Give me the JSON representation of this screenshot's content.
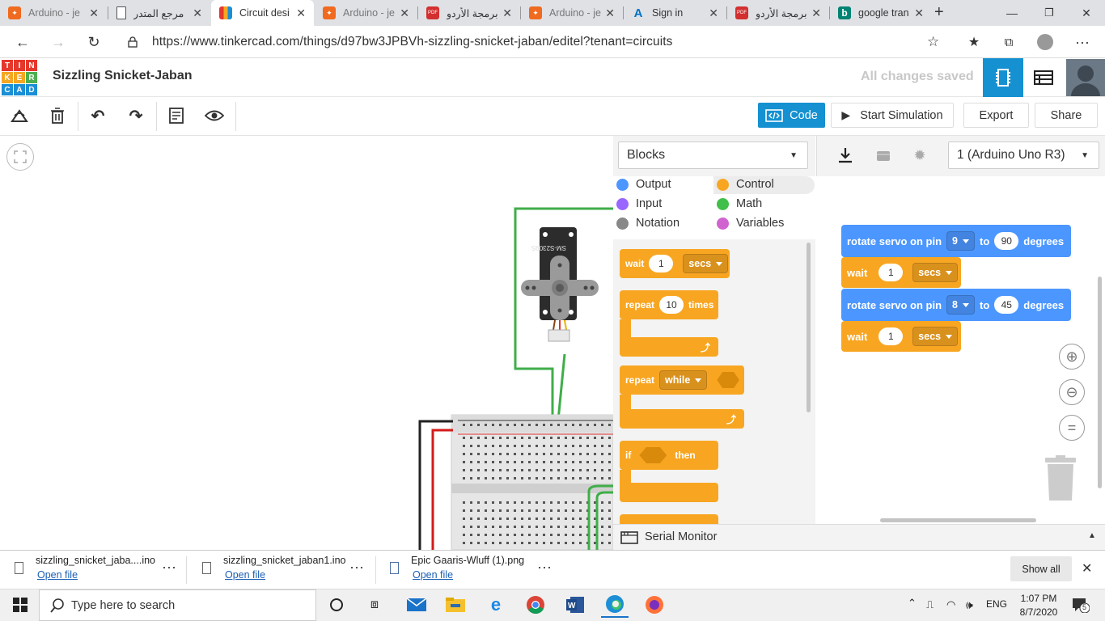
{
  "browser": {
    "tabs": [
      {
        "title": "Arduino - je",
        "icon": "tinkercad-orange-icon",
        "color": "#f06a1f"
      },
      {
        "title": "مرجع المتدر",
        "icon": "page-icon",
        "color": "#ffffff"
      },
      {
        "title": "Circuit desi",
        "icon": "tinkercad-logo-icon",
        "color": "#e5372b"
      },
      {
        "title": "Arduino - je",
        "icon": "tinkercad-orange-icon",
        "color": "#f06a1f"
      },
      {
        "title": "برمجة الأردو",
        "icon": "pdf-icon",
        "color": "#d32f2f"
      },
      {
        "title": "Arduino - je",
        "icon": "tinkercad-orange-icon",
        "color": "#f06a1f"
      },
      {
        "title": "Sign in",
        "icon": "azure-icon",
        "color": "#0072c6"
      },
      {
        "title": "برمجة الأردو",
        "icon": "pdf-icon",
        "color": "#d32f2f"
      },
      {
        "title": "google tran",
        "icon": "bing-icon",
        "color": "#008373"
      }
    ],
    "url": "https://www.tinkercad.com/things/d97bw3JPBVh-sizzling-snicket-jaban/editel?tenant=circuits"
  },
  "header": {
    "logo_letters": [
      "T",
      "I",
      "N",
      "K",
      "E",
      "R",
      "C",
      "A",
      "D"
    ],
    "project_title": "Sizzling Snicket-Jaban",
    "save_status": "All changes saved"
  },
  "toolbar": {
    "code_label": "Code",
    "simulate_label": "Start Simulation",
    "export_label": "Export",
    "share_label": "Share"
  },
  "code_panel": {
    "mode_select": "Blocks",
    "device_select": "1 (Arduino Uno R3)",
    "categories": [
      {
        "label": "Output",
        "color": "#4c97ff"
      },
      {
        "label": "Control",
        "color": "#f8a622"
      },
      {
        "label": "Input",
        "color": "#9966ff"
      },
      {
        "label": "Math",
        "color": "#40bf4a"
      },
      {
        "label": "Notation",
        "color": "#888888"
      },
      {
        "label": "Variables",
        "color": "#cf63cf"
      }
    ],
    "palette": {
      "wait": {
        "label": "wait",
        "value": "1",
        "unit": "secs"
      },
      "repeat_times": {
        "label": "repeat",
        "value": "10",
        "suffix": "times"
      },
      "repeat_while": {
        "label": "repeat",
        "mode": "while"
      },
      "if_then": {
        "label": "if",
        "suffix": "then"
      }
    },
    "script": [
      {
        "label": "rotate servo on pin",
        "pin": "9",
        "to": "to",
        "degrees": "90",
        "unit": "degrees"
      },
      {
        "label": "wait",
        "value": "1",
        "unit": "secs"
      },
      {
        "label": "rotate servo on pin",
        "pin": "8",
        "to": "to",
        "degrees": "45",
        "unit": "degrees"
      },
      {
        "label": "wait",
        "value": "1",
        "unit": "secs"
      }
    ],
    "serial_monitor": "Serial Monitor"
  },
  "servo": {
    "label": "SM-S2309S"
  },
  "downloads": [
    {
      "name": "sizzling_snicket_jaba....ino",
      "action": "Open file"
    },
    {
      "name": "sizzling_snicket_jaban1.ino",
      "action": "Open file"
    },
    {
      "name": "Epic Gaaris-Wluff (1).png",
      "action": "Open file"
    }
  ],
  "downloads_show_all": "Show all",
  "taskbar": {
    "search_placeholder": "Type here to search",
    "language": "ENG",
    "time": "1:07 PM",
    "date": "8/7/2020",
    "notification_count": "5"
  }
}
